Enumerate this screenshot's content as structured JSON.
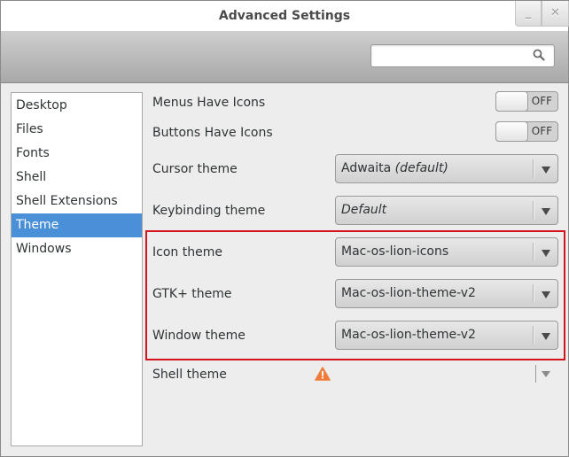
{
  "window": {
    "title": "Advanced Settings",
    "minimize_label": "_",
    "close_label": "✕"
  },
  "toolbar": {
    "search_placeholder": "",
    "search_value": ""
  },
  "sidebar": {
    "items": [
      {
        "label": "Desktop",
        "selected": false
      },
      {
        "label": "Files",
        "selected": false
      },
      {
        "label": "Fonts",
        "selected": false
      },
      {
        "label": "Shell",
        "selected": false
      },
      {
        "label": "Shell Extensions",
        "selected": false
      },
      {
        "label": "Theme",
        "selected": true
      },
      {
        "label": "Windows",
        "selected": false
      }
    ]
  },
  "settings": {
    "menus_have_icons": {
      "label": "Menus Have Icons",
      "state": "OFF"
    },
    "buttons_have_icons": {
      "label": "Buttons Have Icons",
      "state": "OFF"
    },
    "cursor_theme": {
      "label": "Cursor theme",
      "value": "Adwaita",
      "suffix": "(default)"
    },
    "keybinding_theme": {
      "label": "Keybinding theme",
      "value": "Default"
    },
    "icon_theme": {
      "label": "Icon theme",
      "value": "Mac-os-lion-icons"
    },
    "gtk_theme": {
      "label": "GTK+ theme",
      "value": "Mac-os-lion-theme-v2"
    },
    "window_theme": {
      "label": "Window theme",
      "value": "Mac-os-lion-theme-v2"
    },
    "shell_theme": {
      "label": "Shell theme",
      "value": "",
      "warning_icon": "warning-icon"
    }
  },
  "colors": {
    "selection": "#4a90d9",
    "highlight_border": "#d4141c",
    "warning": "#f07c3c"
  }
}
